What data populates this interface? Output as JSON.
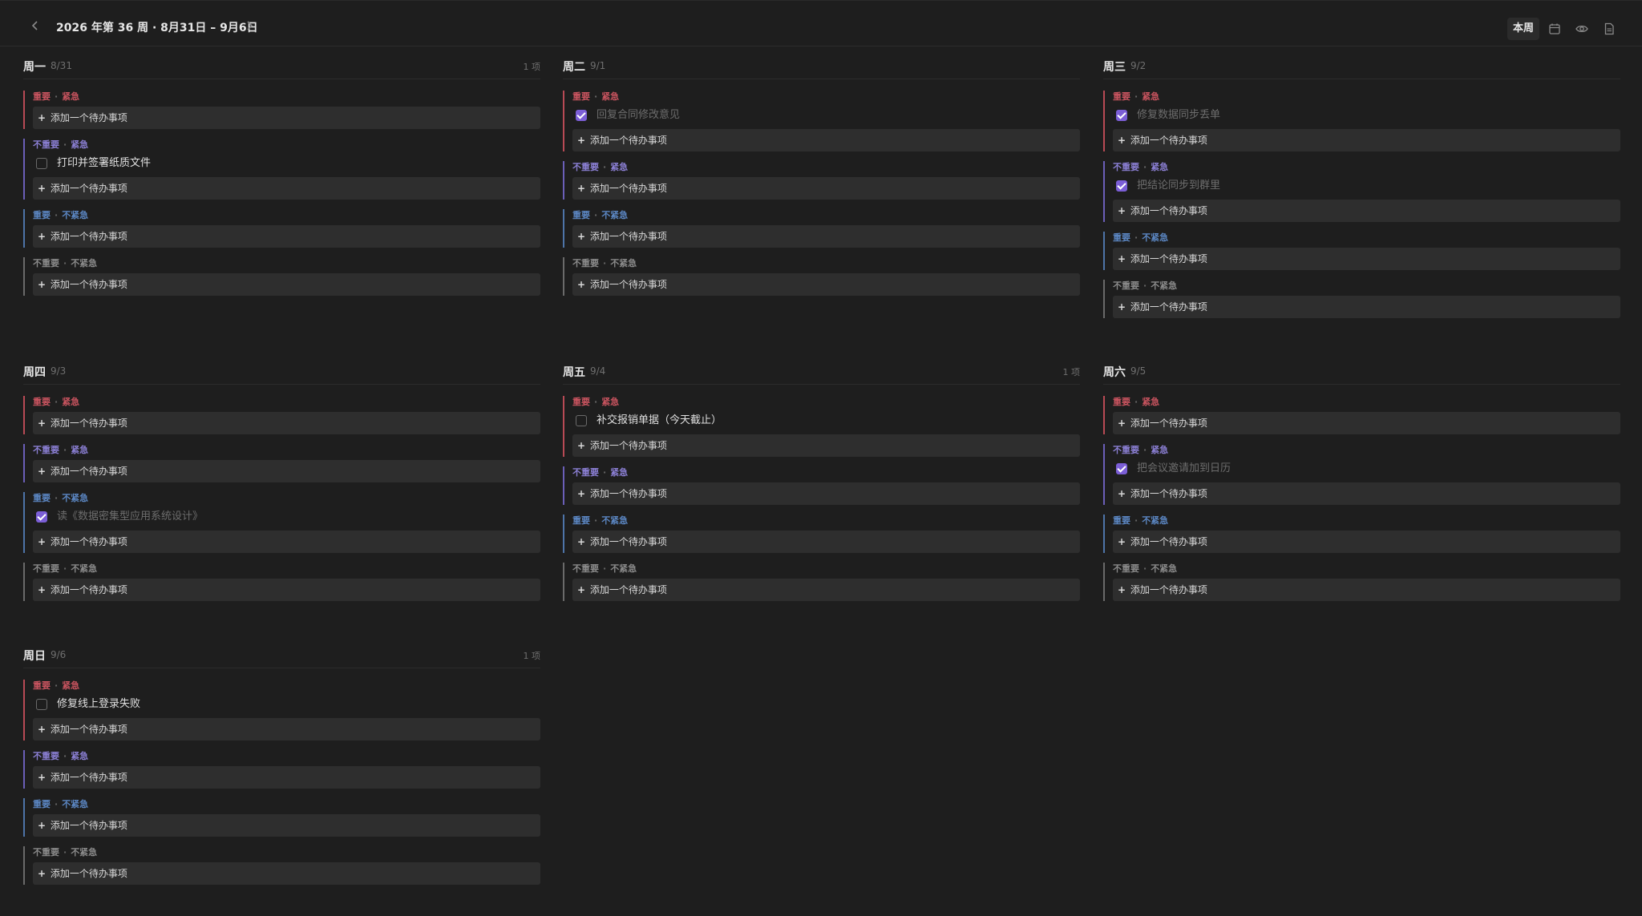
{
  "toolbar": {
    "week_title": "2026 年第 36 周 · 8月31日 – 9月6日",
    "this_week_label": "本周"
  },
  "labels": {
    "important": "重要",
    "not_important": "不重要",
    "urgent": "紧急",
    "not_urgent": "不紧急",
    "add_todo": "添加一个待办事项",
    "plus": "+",
    "separator": "·"
  },
  "days": [
    {
      "name": "周一",
      "date": "8/31",
      "count": "1 项",
      "q1": [],
      "q2": [
        {
          "text": "打印并签署纸质文件",
          "done": false
        }
      ],
      "q3": [],
      "q4": []
    },
    {
      "name": "周二",
      "date": "9/1",
      "count": "",
      "q1": [
        {
          "text": "回复合同修改意见",
          "done": true
        }
      ],
      "q2": [],
      "q3": [],
      "q4": []
    },
    {
      "name": "周三",
      "date": "9/2",
      "count": "",
      "q1": [
        {
          "text": "修复数据同步丢单",
          "done": true
        }
      ],
      "q2": [
        {
          "text": "把结论同步到群里",
          "done": true
        }
      ],
      "q3": [],
      "q4": []
    },
    {
      "name": "周四",
      "date": "9/3",
      "count": "",
      "q1": [],
      "q2": [],
      "q3": [
        {
          "text": "读《数据密集型应用系统设计》",
          "done": true
        }
      ],
      "q4": []
    },
    {
      "name": "周五",
      "date": "9/4",
      "count": "1 项",
      "q1": [
        {
          "text": "补交报销单据（今天截止）",
          "done": false
        }
      ],
      "q2": [],
      "q3": [],
      "q4": []
    },
    {
      "name": "周六",
      "date": "9/5",
      "count": "",
      "q1": [],
      "q2": [
        {
          "text": "把会议邀请加到日历",
          "done": true
        }
      ],
      "q3": [],
      "q4": []
    },
    {
      "name": "周日",
      "date": "9/6",
      "count": "1 项",
      "q1": [
        {
          "text": "修复线上登录失败",
          "done": false
        }
      ],
      "q2": [],
      "q3": [],
      "q4": []
    }
  ]
}
